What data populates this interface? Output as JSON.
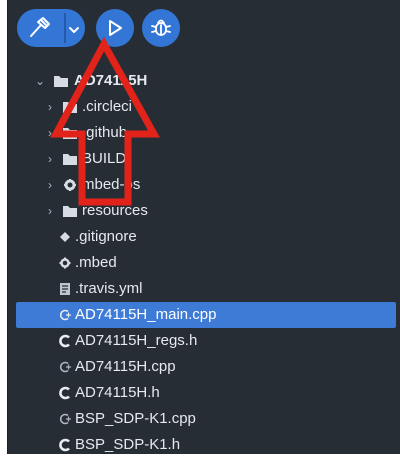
{
  "toolbar": {
    "build_icon": "hammer-icon",
    "dropdown_icon": "chevron-down-icon",
    "run_icon": "play-icon",
    "debug_icon": "bug-icon"
  },
  "tree": {
    "root": {
      "label": "AD74115H",
      "icon": "folder-icon",
      "expanded": true
    },
    "items": [
      {
        "label": ".circleci",
        "type": "folder",
        "icon": "folder-icon"
      },
      {
        "label": ".github",
        "type": "folder",
        "icon": "folder-icon"
      },
      {
        "label": "BUILD",
        "type": "folder",
        "icon": "folder-icon"
      },
      {
        "label": "mbed-os",
        "type": "folder",
        "icon": "gear-icon"
      },
      {
        "label": "resources",
        "type": "folder",
        "icon": "folder-icon"
      },
      {
        "label": ".gitignore",
        "type": "file",
        "icon": "diamond-icon"
      },
      {
        "label": ".mbed",
        "type": "file",
        "icon": "gear-icon"
      },
      {
        "label": ".travis.yml",
        "type": "file",
        "icon": "yaml-file-icon"
      },
      {
        "label": "AD74115H_main.cpp",
        "type": "file",
        "icon": "cpp-file-icon",
        "selected": true
      },
      {
        "label": "AD74115H_regs.h",
        "type": "file",
        "icon": "c-header-icon"
      },
      {
        "label": "AD74115H.cpp",
        "type": "file",
        "icon": "cpp-file-icon"
      },
      {
        "label": "AD74115H.h",
        "type": "file",
        "icon": "c-header-icon"
      },
      {
        "label": "BSP_SDP-K1.cpp",
        "type": "file",
        "icon": "cpp-file-icon"
      },
      {
        "label": "BSP_SDP-K1.h",
        "type": "file",
        "icon": "c-header-icon"
      }
    ]
  },
  "annotation": {
    "arrow_color": "#e2231a",
    "icon": "up-arrow-icon"
  },
  "colors": {
    "panel_bg": "#262d35",
    "button_bg": "#3376d6",
    "selection_bg": "#3d7bd6",
    "text": "#e6e9ee"
  }
}
